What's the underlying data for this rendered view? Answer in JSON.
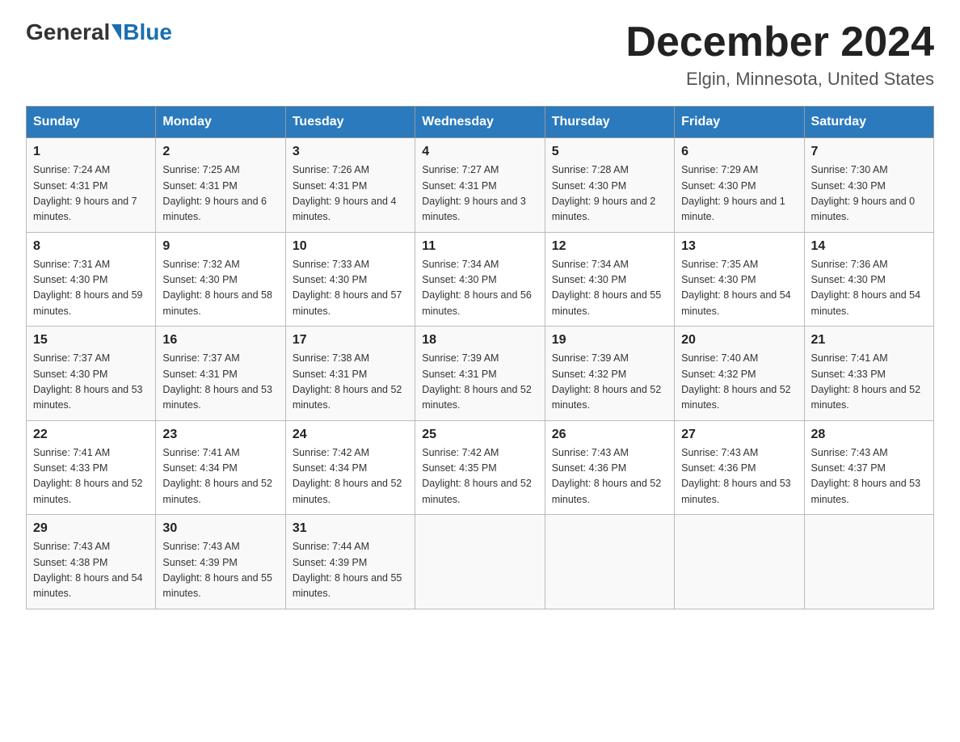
{
  "header": {
    "logo_general": "General",
    "logo_blue": "Blue",
    "month_title": "December 2024",
    "location": "Elgin, Minnesota, United States"
  },
  "days_of_week": [
    "Sunday",
    "Monday",
    "Tuesday",
    "Wednesday",
    "Thursday",
    "Friday",
    "Saturday"
  ],
  "weeks": [
    [
      {
        "day": "1",
        "sunrise": "7:24 AM",
        "sunset": "4:31 PM",
        "daylight": "9 hours and 7 minutes."
      },
      {
        "day": "2",
        "sunrise": "7:25 AM",
        "sunset": "4:31 PM",
        "daylight": "9 hours and 6 minutes."
      },
      {
        "day": "3",
        "sunrise": "7:26 AM",
        "sunset": "4:31 PM",
        "daylight": "9 hours and 4 minutes."
      },
      {
        "day": "4",
        "sunrise": "7:27 AM",
        "sunset": "4:31 PM",
        "daylight": "9 hours and 3 minutes."
      },
      {
        "day": "5",
        "sunrise": "7:28 AM",
        "sunset": "4:30 PM",
        "daylight": "9 hours and 2 minutes."
      },
      {
        "day": "6",
        "sunrise": "7:29 AM",
        "sunset": "4:30 PM",
        "daylight": "9 hours and 1 minute."
      },
      {
        "day": "7",
        "sunrise": "7:30 AM",
        "sunset": "4:30 PM",
        "daylight": "9 hours and 0 minutes."
      }
    ],
    [
      {
        "day": "8",
        "sunrise": "7:31 AM",
        "sunset": "4:30 PM",
        "daylight": "8 hours and 59 minutes."
      },
      {
        "day": "9",
        "sunrise": "7:32 AM",
        "sunset": "4:30 PM",
        "daylight": "8 hours and 58 minutes."
      },
      {
        "day": "10",
        "sunrise": "7:33 AM",
        "sunset": "4:30 PM",
        "daylight": "8 hours and 57 minutes."
      },
      {
        "day": "11",
        "sunrise": "7:34 AM",
        "sunset": "4:30 PM",
        "daylight": "8 hours and 56 minutes."
      },
      {
        "day": "12",
        "sunrise": "7:34 AM",
        "sunset": "4:30 PM",
        "daylight": "8 hours and 55 minutes."
      },
      {
        "day": "13",
        "sunrise": "7:35 AM",
        "sunset": "4:30 PM",
        "daylight": "8 hours and 54 minutes."
      },
      {
        "day": "14",
        "sunrise": "7:36 AM",
        "sunset": "4:30 PM",
        "daylight": "8 hours and 54 minutes."
      }
    ],
    [
      {
        "day": "15",
        "sunrise": "7:37 AM",
        "sunset": "4:30 PM",
        "daylight": "8 hours and 53 minutes."
      },
      {
        "day": "16",
        "sunrise": "7:37 AM",
        "sunset": "4:31 PM",
        "daylight": "8 hours and 53 minutes."
      },
      {
        "day": "17",
        "sunrise": "7:38 AM",
        "sunset": "4:31 PM",
        "daylight": "8 hours and 52 minutes."
      },
      {
        "day": "18",
        "sunrise": "7:39 AM",
        "sunset": "4:31 PM",
        "daylight": "8 hours and 52 minutes."
      },
      {
        "day": "19",
        "sunrise": "7:39 AM",
        "sunset": "4:32 PM",
        "daylight": "8 hours and 52 minutes."
      },
      {
        "day": "20",
        "sunrise": "7:40 AM",
        "sunset": "4:32 PM",
        "daylight": "8 hours and 52 minutes."
      },
      {
        "day": "21",
        "sunrise": "7:41 AM",
        "sunset": "4:33 PM",
        "daylight": "8 hours and 52 minutes."
      }
    ],
    [
      {
        "day": "22",
        "sunrise": "7:41 AM",
        "sunset": "4:33 PM",
        "daylight": "8 hours and 52 minutes."
      },
      {
        "day": "23",
        "sunrise": "7:41 AM",
        "sunset": "4:34 PM",
        "daylight": "8 hours and 52 minutes."
      },
      {
        "day": "24",
        "sunrise": "7:42 AM",
        "sunset": "4:34 PM",
        "daylight": "8 hours and 52 minutes."
      },
      {
        "day": "25",
        "sunrise": "7:42 AM",
        "sunset": "4:35 PM",
        "daylight": "8 hours and 52 minutes."
      },
      {
        "day": "26",
        "sunrise": "7:43 AM",
        "sunset": "4:36 PM",
        "daylight": "8 hours and 52 minutes."
      },
      {
        "day": "27",
        "sunrise": "7:43 AM",
        "sunset": "4:36 PM",
        "daylight": "8 hours and 53 minutes."
      },
      {
        "day": "28",
        "sunrise": "7:43 AM",
        "sunset": "4:37 PM",
        "daylight": "8 hours and 53 minutes."
      }
    ],
    [
      {
        "day": "29",
        "sunrise": "7:43 AM",
        "sunset": "4:38 PM",
        "daylight": "8 hours and 54 minutes."
      },
      {
        "day": "30",
        "sunrise": "7:43 AM",
        "sunset": "4:39 PM",
        "daylight": "8 hours and 55 minutes."
      },
      {
        "day": "31",
        "sunrise": "7:44 AM",
        "sunset": "4:39 PM",
        "daylight": "8 hours and 55 minutes."
      },
      null,
      null,
      null,
      null
    ]
  ],
  "labels": {
    "sunrise": "Sunrise:",
    "sunset": "Sunset:",
    "daylight": "Daylight:"
  }
}
